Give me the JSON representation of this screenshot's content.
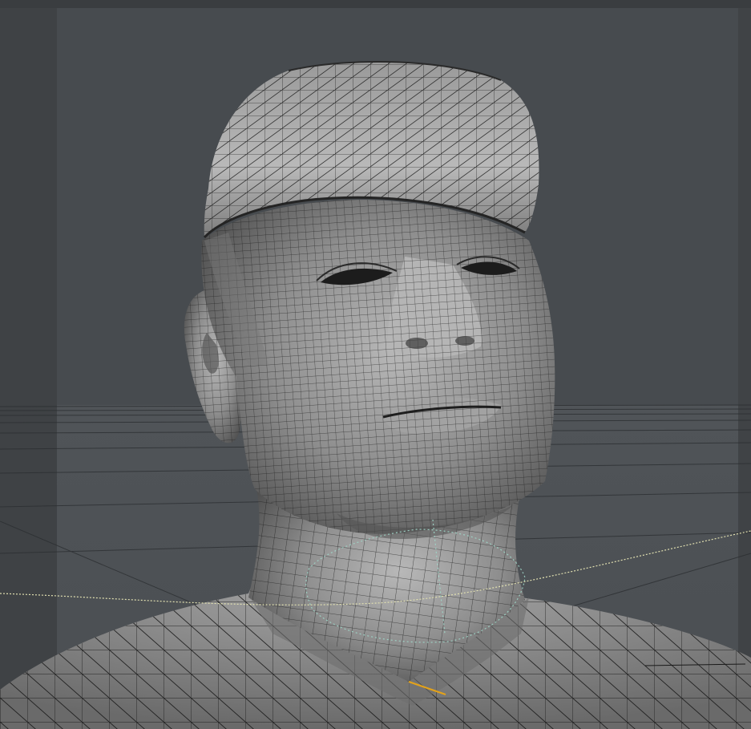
{
  "viewport": {
    "view": "perspective",
    "shading": "smooth-shaded-with-wireframe",
    "subject": "head-and-shoulders-bust",
    "colors": {
      "background": "#474b4f",
      "safe_frame": "#3f4245",
      "mesh_fill": "#8c8c8c",
      "wire": "#1a1a1a",
      "selection_dotted": "#9fd6c8",
      "guide_curve": "#e0dfb0",
      "highlight_edge": "#e3a21a"
    }
  }
}
